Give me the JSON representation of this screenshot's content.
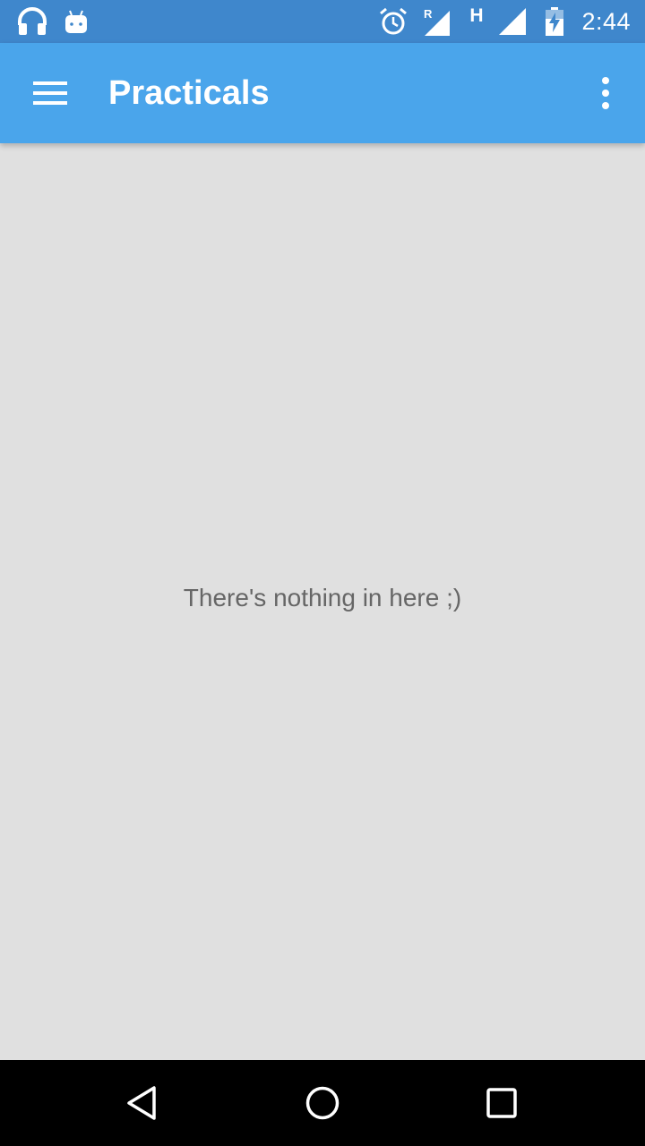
{
  "status_bar": {
    "time": "2:44",
    "background": "#3f87cc",
    "icons": [
      "headphones-icon",
      "android-icon",
      "alarm-icon",
      "signal-roaming-icon",
      "network-type-h-icon",
      "signal-icon",
      "battery-charging-icon"
    ],
    "roaming_label": "R",
    "network_type": "H"
  },
  "app_bar": {
    "title": "Practicals",
    "background": "#4aa5eb",
    "menu_icon": "hamburger-menu-icon",
    "overflow_icon": "more-vert-icon"
  },
  "content": {
    "background": "#e0e0e0",
    "empty_message": "There's nothing in here ;)"
  },
  "nav_bar": {
    "buttons": [
      "back-icon",
      "home-icon",
      "recents-icon"
    ]
  }
}
